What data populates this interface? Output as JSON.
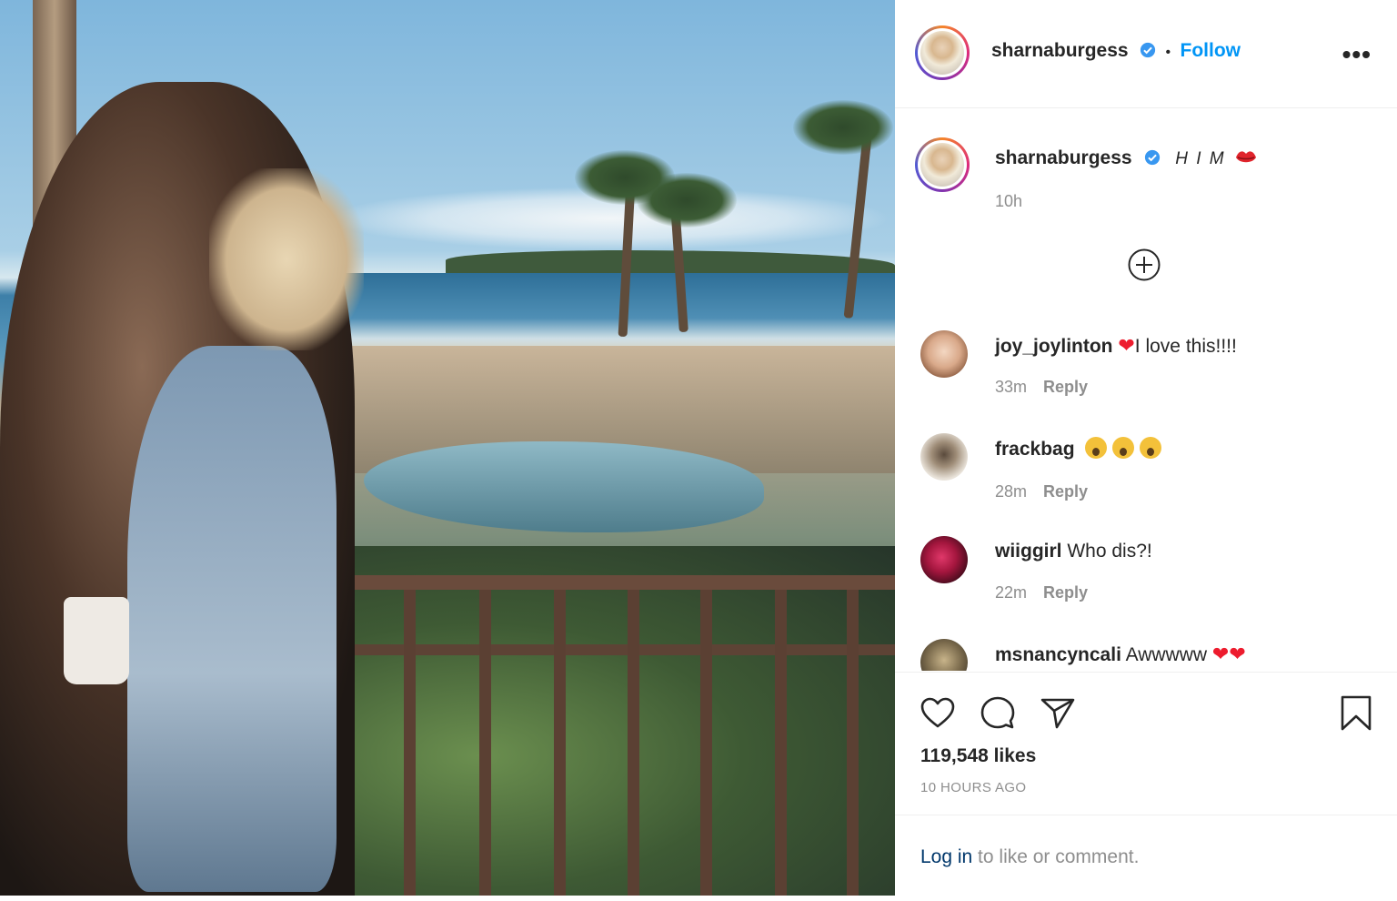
{
  "post": {
    "username": "sharnaburgess",
    "follow_label": "Follow",
    "separator": "•",
    "more_label": "•••"
  },
  "caption": {
    "username": "sharnaburgess",
    "text": "H I M",
    "time": "10h"
  },
  "comments": [
    {
      "username": "joy_joylinton",
      "text": "I love this!!!!",
      "time": "33m",
      "reply": "Reply"
    },
    {
      "username": "frackbag",
      "text": "",
      "time": "28m",
      "reply": "Reply"
    },
    {
      "username": "wiiggirl",
      "text": "Who dis?!",
      "time": "22m",
      "reply": "Reply"
    },
    {
      "username": "msnancyncali",
      "text": "Awwwww"
    }
  ],
  "stats": {
    "likes": "119,548 likes",
    "posted": "10 HOURS AGO"
  },
  "login": {
    "link": "Log in",
    "rest": " to like or comment."
  },
  "icons": {
    "like": "heart-icon",
    "comment": "comment-icon",
    "share": "share-icon",
    "save": "bookmark-icon",
    "verified": "verified-badge-icon",
    "load_more": "plus-circle-icon"
  },
  "colors": {
    "follow": "#0095f6",
    "verified": "#3897f0",
    "secondary_text": "#8e8e8e",
    "heart": "#ed1c2e"
  }
}
